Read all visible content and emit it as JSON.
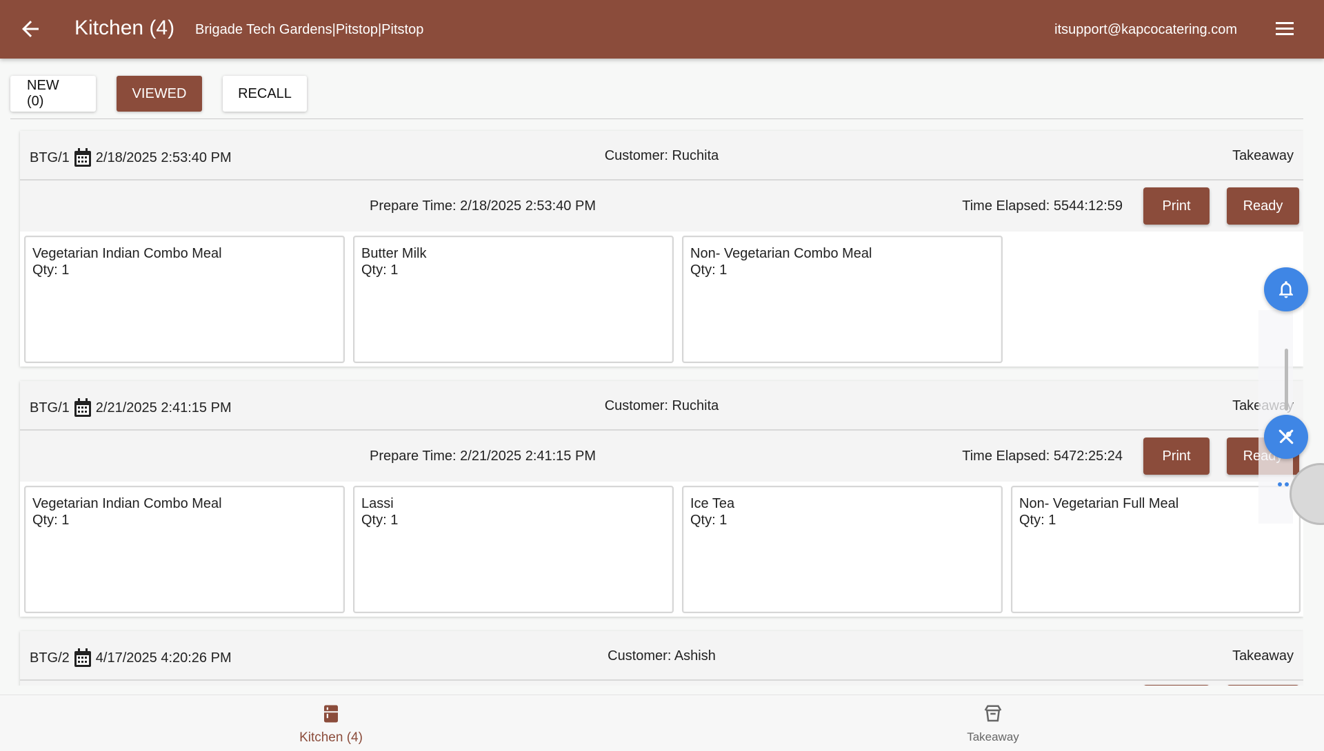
{
  "header": {
    "title": "Kitchen (4)",
    "subtitle": "Brigade Tech Gardens|Pitstop|Pitstop",
    "user_email": "itsupport@kapcocatering.com",
    "color": "#8b4c3b"
  },
  "tabs": [
    {
      "label": "NEW (0)",
      "active": false
    },
    {
      "label": "VIEWED",
      "active": true
    },
    {
      "label": "RECALL",
      "active": false
    }
  ],
  "orders": [
    {
      "id": "BTG/1",
      "datetime": "2/18/2025 2:53:40 PM",
      "customer": "Customer: Ruchita",
      "type": "Takeaway",
      "prepare_time": "Prepare Time: 2/18/2025 2:53:40 PM",
      "elapsed": "Time Elapsed: 5544:12:59",
      "print_label": "Print",
      "ready_label": "Ready",
      "items": [
        {
          "name": "Vegetarian Indian Combo Meal",
          "qty": "Qty: 1"
        },
        {
          "name": "Butter Milk",
          "qty": "Qty: 1"
        },
        {
          "name": "Non- Vegetarian Combo Meal",
          "qty": "Qty: 1"
        }
      ]
    },
    {
      "id": "BTG/1",
      "datetime": "2/21/2025 2:41:15 PM",
      "customer": "Customer: Ruchita",
      "type": "Takeaway",
      "prepare_time": "Prepare Time: 2/21/2025 2:41:15 PM",
      "elapsed": "Time Elapsed: 5472:25:24",
      "print_label": "Print",
      "ready_label": "Ready",
      "items": [
        {
          "name": "Vegetarian Indian Combo Meal",
          "qty": "Qty: 1"
        },
        {
          "name": "Lassi",
          "qty": "Qty: 1"
        },
        {
          "name": "Ice Tea",
          "qty": "Qty: 1"
        },
        {
          "name": "Non- Vegetarian Full Meal",
          "qty": "Qty: 1"
        }
      ]
    },
    {
      "id": "BTG/2",
      "datetime": "4/17/2025 4:20:26 PM",
      "customer": "Customer: Ashish",
      "type": "Takeaway"
    }
  ],
  "bottom_nav": [
    {
      "label": "Kitchen (4)",
      "icon": "kitchen-icon",
      "active": true
    },
    {
      "label": "Takeaway",
      "icon": "takeaway-icon",
      "active": false
    }
  ],
  "floating": {
    "bell_icon": "bell-icon",
    "tool_icon": "tools-icon",
    "more_icon": "more-dots-icon",
    "color": "#3f86e5"
  }
}
